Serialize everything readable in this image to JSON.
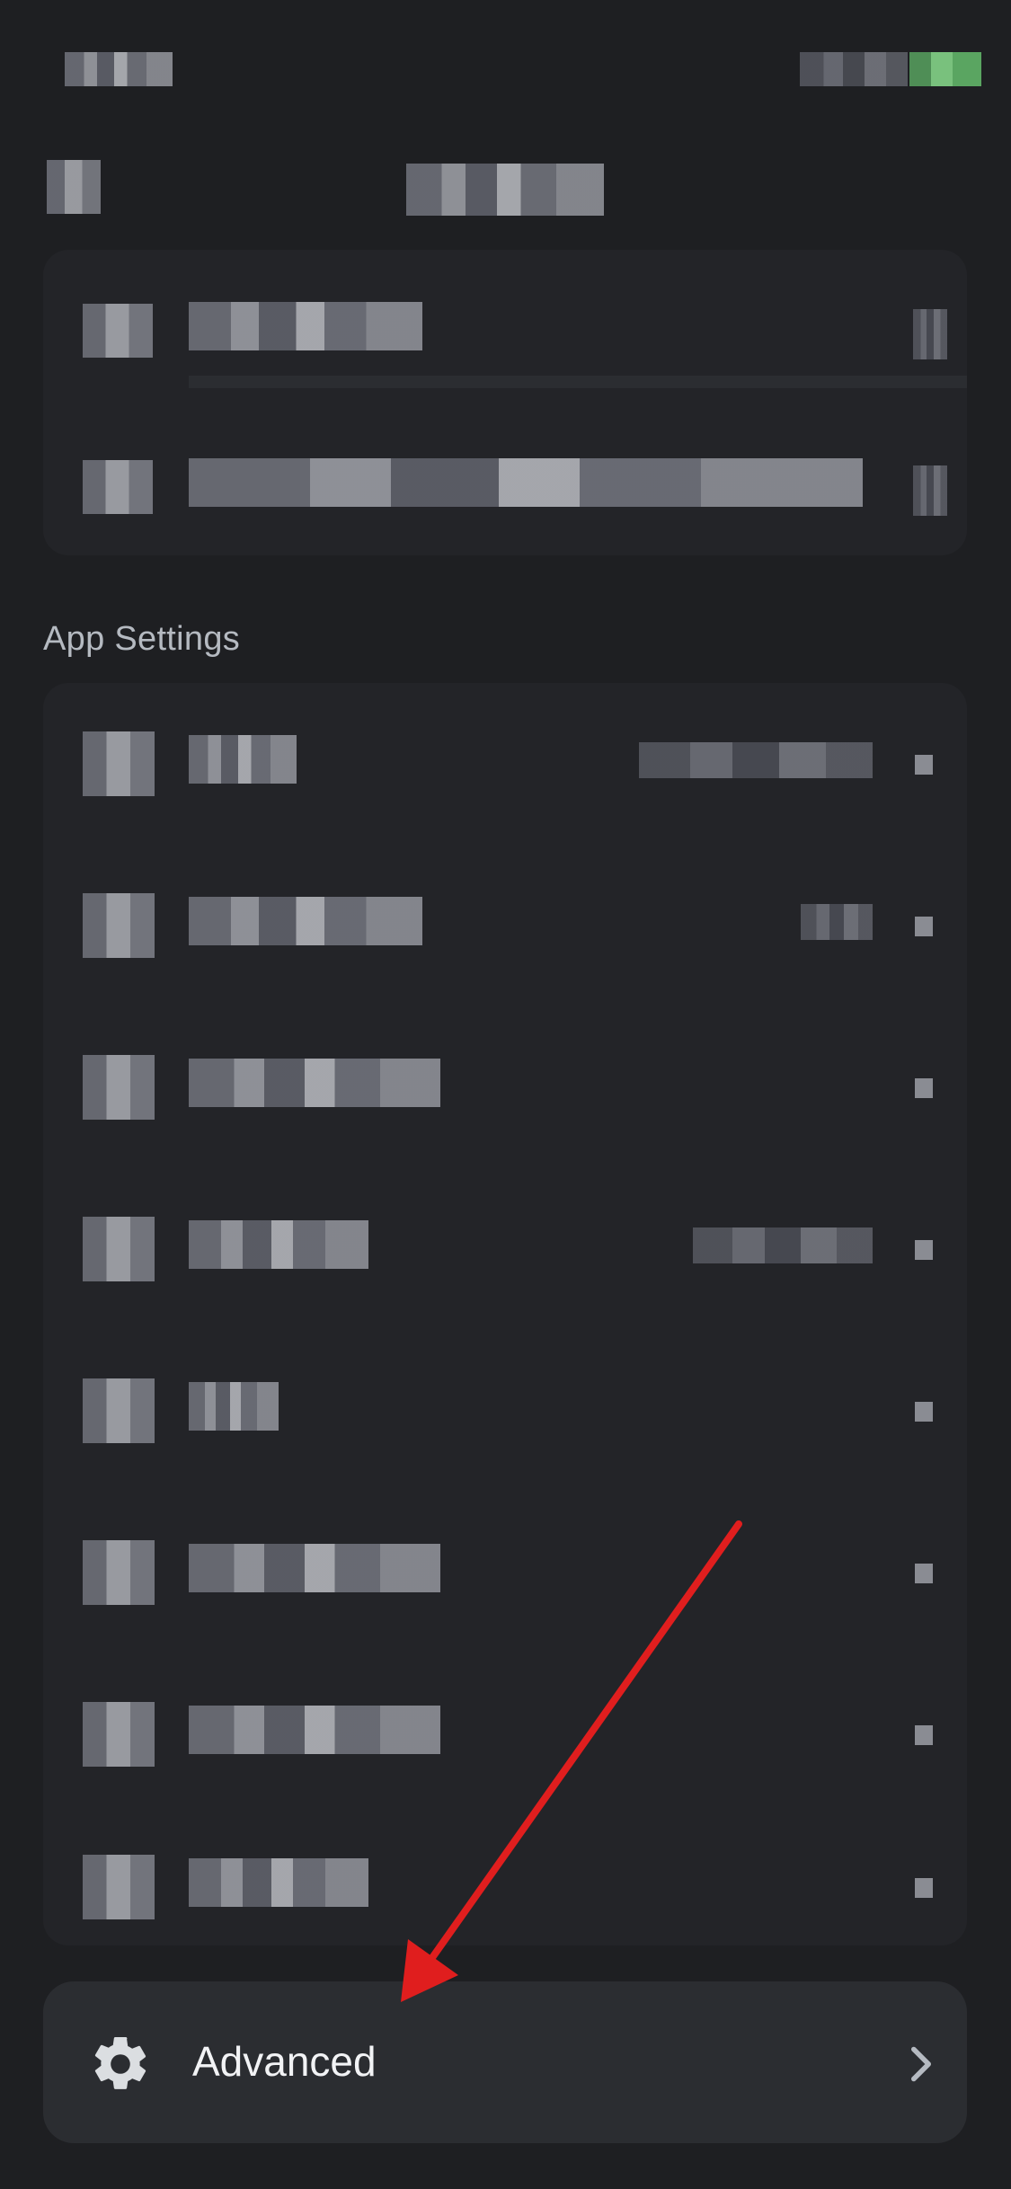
{
  "section": {
    "app_settings_label": "App Settings"
  },
  "advanced": {
    "label": "Advanced"
  },
  "colors": {
    "background": "#1e1f22",
    "panel": "#232428",
    "advanced_row": "#2b2d31",
    "annotation_arrow": "#e01e1e"
  },
  "icons": {
    "advanced": "gear-icon",
    "chevron": "chevron-right-icon",
    "back": "back-icon"
  }
}
